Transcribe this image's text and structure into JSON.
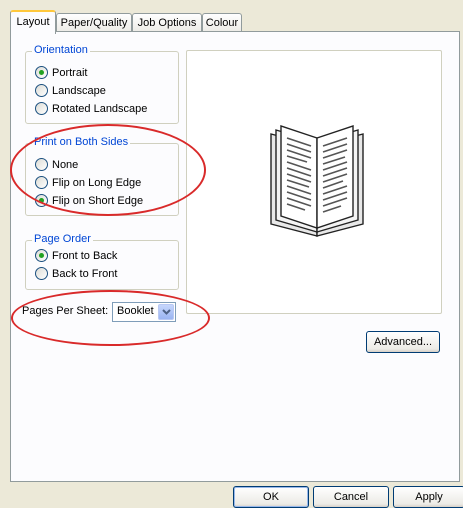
{
  "tabs": [
    {
      "label": "Layout"
    },
    {
      "label": "Paper/Quality"
    },
    {
      "label": "Job Options"
    },
    {
      "label": "Colour"
    }
  ],
  "orientation": {
    "legend": "Orientation",
    "options": [
      {
        "label": "Portrait",
        "selected": true
      },
      {
        "label": "Landscape",
        "selected": false
      },
      {
        "label": "Rotated Landscape",
        "selected": false
      }
    ]
  },
  "both_sides": {
    "legend": "Print on Both Sides",
    "options": [
      {
        "label": "None",
        "selected": false
      },
      {
        "label": "Flip on Long Edge",
        "selected": false
      },
      {
        "label": "Flip on Short Edge",
        "selected": true
      }
    ]
  },
  "page_order": {
    "legend": "Page Order",
    "options": [
      {
        "label": "Front to Back",
        "selected": true
      },
      {
        "label": "Back to Front",
        "selected": false
      }
    ]
  },
  "pages_per_sheet": {
    "label": "Pages Per Sheet:",
    "value": "Booklet"
  },
  "advanced_label": "Advanced...",
  "footer": {
    "ok": "OK",
    "cancel": "Cancel",
    "apply": "Apply"
  },
  "icons": {
    "preview": "open-book-icon",
    "dropdown": "chevron-down-icon"
  },
  "colors": {
    "group_legend": "#0046D5",
    "annotation": "#D92A2A",
    "tab_highlight": "#FFC83C"
  }
}
